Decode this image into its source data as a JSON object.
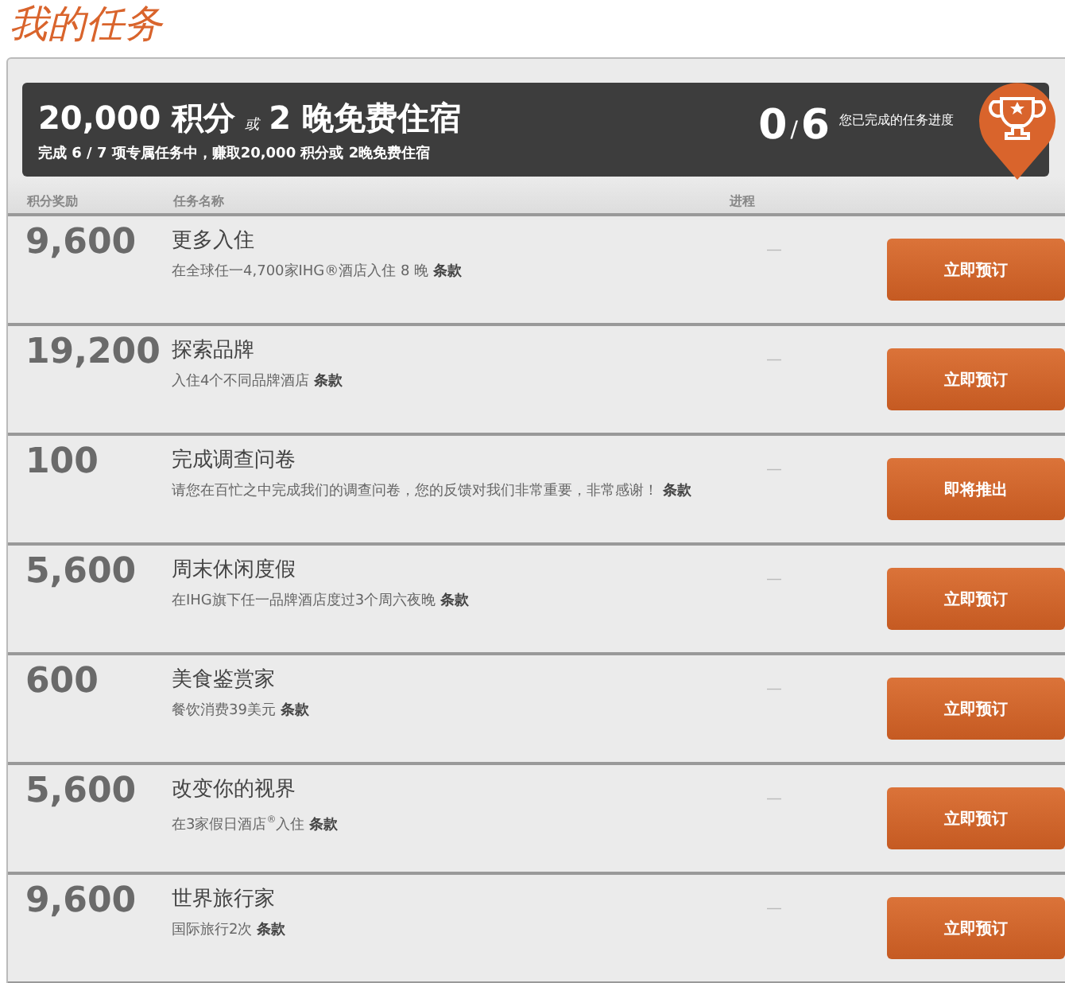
{
  "page_title": "我的任务",
  "banner": {
    "headline_points": "20,000 积分",
    "headline_or": "或",
    "headline_nights": "2 晚免费住宿",
    "subtitle": "完成 6 / 7 项专属任务中，赚取20,000 积分或 2晚免费住宿",
    "progress_done": "0",
    "progress_sep": "/",
    "progress_total": "6",
    "progress_label": "您已完成的任务进度"
  },
  "table": {
    "columns": [
      "积分奖励",
      "任务名称",
      "进程"
    ],
    "rows": [
      {
        "points": "9,600",
        "name": "更多入住",
        "description": "在全球任一4,700家IHG®酒店入住 8 晚 **条款**",
        "progress": "—",
        "action": "立即预订"
      },
      {
        "points": "19,200",
        "name": "探索品牌",
        "description": "入住4个不同品牌酒店 **条款**",
        "progress": "—",
        "action": "立即预订"
      },
      {
        "points": "100",
        "name": "完成调查问卷",
        "description": "请您在百忙之中完成我们的调查问卷，您的反馈对我们非常重要，非常感谢！ **条款**",
        "progress": "—",
        "action": "即将推出"
      },
      {
        "points": "5,600",
        "name": "周末休闲度假",
        "description": "在IHG旗下任一品牌酒店度过3个周六夜晚 **条款**",
        "progress": "—",
        "action": "立即预订"
      },
      {
        "points": "600",
        "name": "美食鉴赏家",
        "description": "餐饮消费39美元 **条款**",
        "progress": "—",
        "action": "立即预订"
      },
      {
        "points": "5,600",
        "name": "改变你的视界",
        "description": "在3家假日酒店$^{®}$入住 **条款**",
        "progress": "—",
        "action": "立即预订"
      },
      {
        "points": "9,600",
        "name": "世界旅行家",
        "description": "国际旅行2次 **条款**",
        "progress": "—",
        "action": "立即预订"
      }
    ]
  }
}
